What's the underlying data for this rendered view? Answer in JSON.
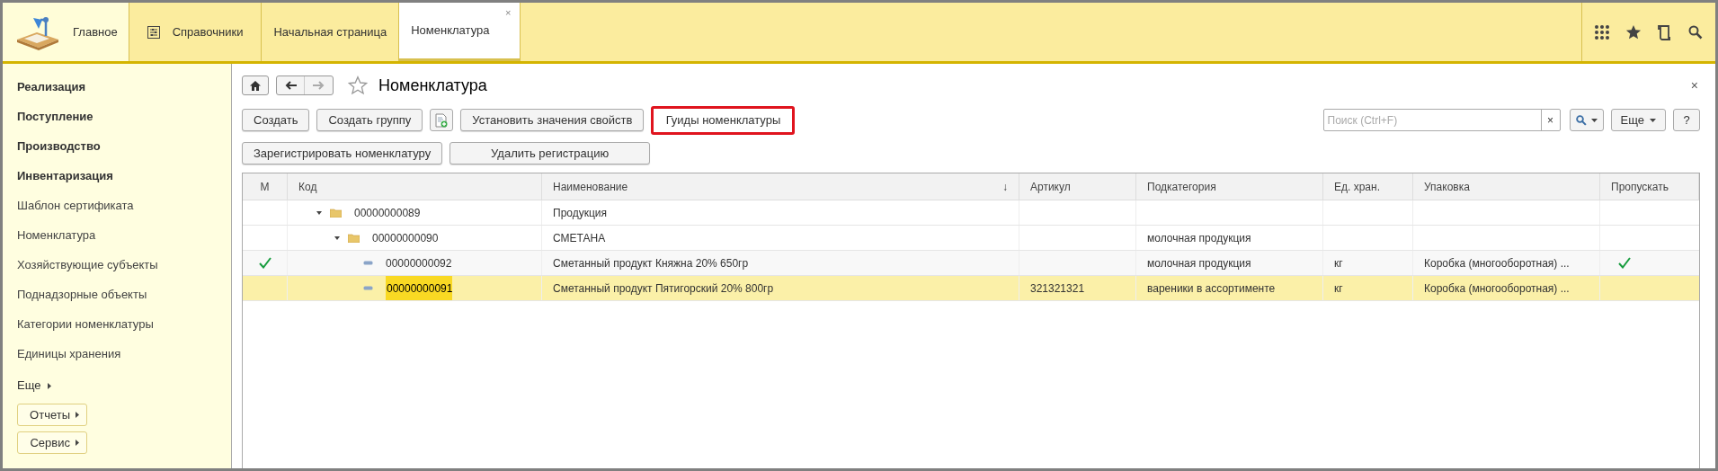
{
  "sections": [
    {
      "label": "Главное",
      "kind": "lamp",
      "selected": true
    },
    {
      "label": "Справочники",
      "kind": "list",
      "selected": false
    }
  ],
  "tabs": [
    {
      "label": "Начальная страница",
      "selected": false,
      "closable": false
    },
    {
      "label": "Номенклатура",
      "selected": true,
      "closable": true,
      "close": "×"
    }
  ],
  "sidebar": {
    "items": [
      {
        "label": "Реализация",
        "bold": true
      },
      {
        "label": "Поступление",
        "bold": true
      },
      {
        "label": "Производство",
        "bold": true
      },
      {
        "label": "Инвентаризация",
        "bold": true
      },
      {
        "label": "Шаблон сертификата",
        "bold": false
      },
      {
        "label": "Номенклатура",
        "bold": false
      },
      {
        "label": "Хозяйствующие субъекты",
        "bold": false
      },
      {
        "label": "Поднадзорные объекты",
        "bold": false
      },
      {
        "label": "Категории номенклатуры",
        "bold": false
      },
      {
        "label": "Единицы хранения",
        "bold": false
      }
    ],
    "more": "Еще",
    "buttons": [
      "Отчеты",
      "Сервис"
    ]
  },
  "form": {
    "title": "Номенклатура",
    "close": "×",
    "toolbar_rows": [
      [
        {
          "kind": "text",
          "label": "Создать",
          "highlighted": false
        },
        {
          "kind": "text",
          "label": "Создать группу",
          "highlighted": false
        },
        {
          "kind": "icon"
        },
        {
          "kind": "text",
          "label": "Установить значения свойств",
          "highlighted": false
        },
        {
          "kind": "text",
          "label": "Гуиды номенклатуры",
          "highlighted": true
        }
      ],
      [
        {
          "kind": "text",
          "label": "Зарегистрировать номенклатуру",
          "highlighted": false
        },
        {
          "kind": "text",
          "label": "Удалить регистрацию",
          "highlighted": false
        }
      ]
    ],
    "search": {
      "placeholder": "Поиск (Ctrl+F)",
      "clear": "×"
    },
    "more": "Еще",
    "help": "?"
  },
  "table": {
    "columns": [
      "М",
      "Код",
      "Наименование",
      "Артикул",
      "Подкатегория",
      "Ед. хран.",
      "Упаковка",
      "Пропускать"
    ],
    "sort_mark": "↓",
    "rows": [
      {
        "kind": "group",
        "expanded": true,
        "selected": false,
        "code": "00000000089",
        "name": "Продукция",
        "children": [
          {
            "kind": "group",
            "expanded": true,
            "selected": false,
            "code": "00000000090",
            "name": "СМЕТАНА",
            "subcategory": "молочная продукция",
            "children": [
              {
                "kind": "item",
                "selected": false,
                "marked": true,
                "skip": true,
                "code": "00000000092",
                "name": "Сметанный продукт Княжна 20% 650гр",
                "subcategory": "молочная продукция",
                "unit": "кг",
                "package": "Коробка (многооборотная) ..."
              },
              {
                "kind": "item",
                "selected": true,
                "marked": false,
                "skip": false,
                "code": "00000000091",
                "name": "Сметанный продукт Пятигорский 20% 800гр",
                "article": "321321321",
                "subcategory": "вареники в ассортименте",
                "unit": "кг",
                "package": "Коробка (многооборотная) ..."
              }
            ]
          }
        ]
      }
    ]
  }
}
